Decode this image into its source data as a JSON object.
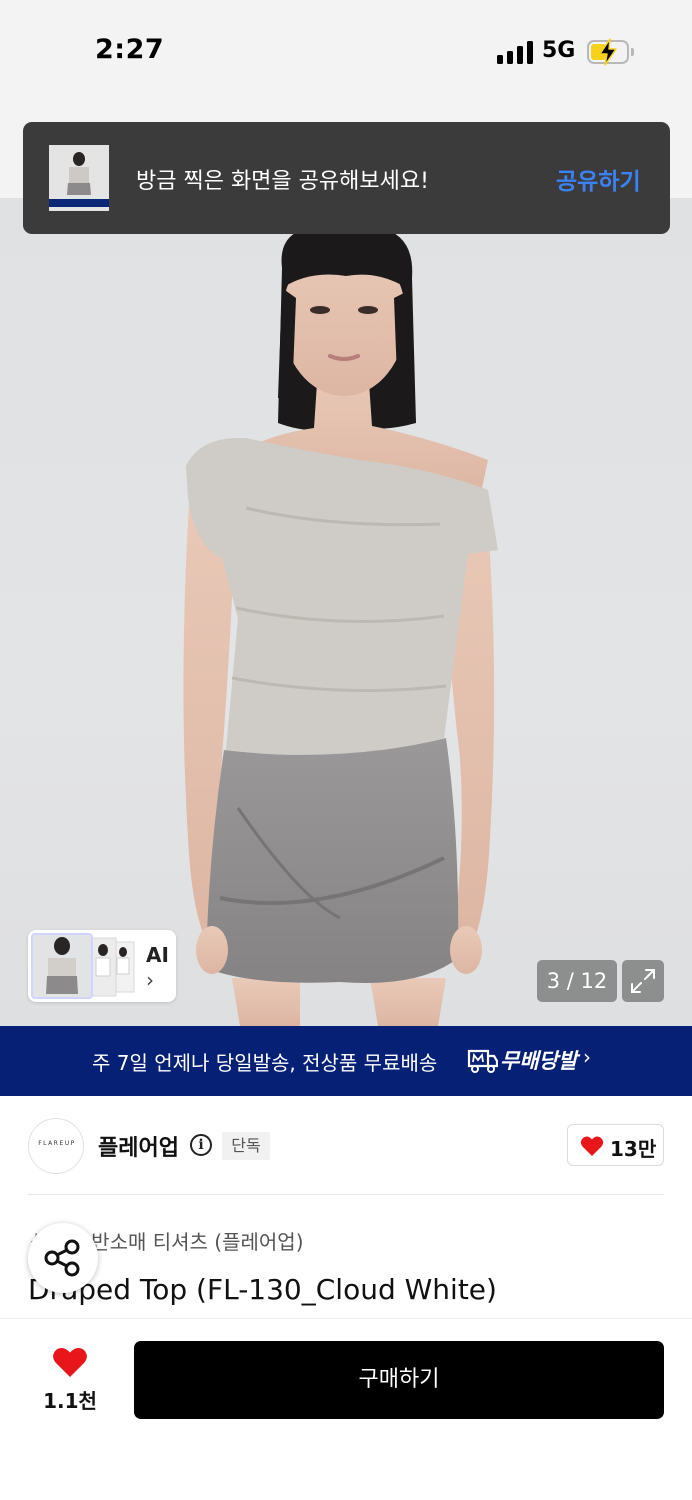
{
  "status_bar": {
    "time": "2:27",
    "network": "5G",
    "signal_bars": 4,
    "battery_level": 0.45,
    "battery_charging": true,
    "icons": [
      "signal-icon",
      "battery-icon",
      "charging-bolt-icon"
    ]
  },
  "toast": {
    "message": "방금 찍은 화면을 공유해보세요!",
    "action_label": "공유하기",
    "action_color": "#3b82f6"
  },
  "gallery": {
    "current": "3 / 12",
    "ai_label": "AI",
    "ai_chevron": "›",
    "icons": [
      "expand-icon"
    ]
  },
  "banner": {
    "text": "주 7일 언제나 당일발송, 전상품 무료배송",
    "brand": "무배당발",
    "chevron": "›",
    "background_color": "#062075",
    "icons": [
      "delivery-truck-icon"
    ]
  },
  "brand": {
    "logo_text": "FLAREUP",
    "name": "플레어업",
    "info_glyph": "i",
    "badge": "단독",
    "likes": "13만",
    "icons": [
      "info-icon",
      "heart-icon"
    ]
  },
  "product": {
    "category_prefix": "상의",
    "category": "반소매 티셔츠 (플레어업)",
    "title": "Draped Top (FL-130_Cloud White)"
  },
  "bottom_bar": {
    "wish_count": "1.1천",
    "buy_label": "구매하기",
    "heart_color": "#e8151b",
    "icons": [
      "heart-icon",
      "share-icon"
    ]
  }
}
